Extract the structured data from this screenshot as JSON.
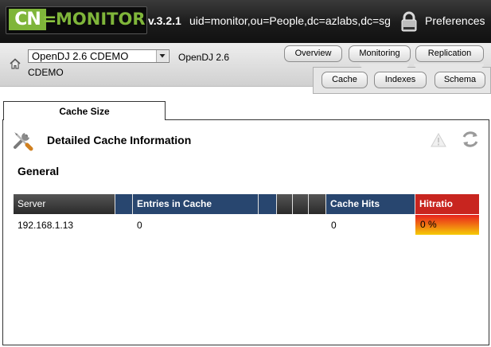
{
  "header": {
    "logo_cn": "CN",
    "logo_eq": "=",
    "logo_word": "MONITOR",
    "version": "v.3.2.1",
    "uid": "uid=monitor,ou=People,dc=azlabs,dc=sg",
    "lock_icon": "lock-icon",
    "preferences": "Preferences",
    "colors": {
      "background": "#1b1b1b",
      "logo_green": "#7fb53a"
    }
  },
  "server_bar": {
    "home_icon": "home-icon",
    "selected_server": "OpenDJ 2.6 CDEMO",
    "server_name_line1": "OpenDJ 2.6",
    "server_name_line2": "CDEMO"
  },
  "nav": {
    "tabs": [
      {
        "label": "Overview"
      },
      {
        "label": "Monitoring"
      },
      {
        "label": "Replication"
      }
    ],
    "subtabs": [
      {
        "label": "Cache"
      },
      {
        "label": "Indexes"
      },
      {
        "label": "Schema"
      }
    ]
  },
  "panel": {
    "tab_label": "Cache Size",
    "title": "Detailed Cache Information",
    "section": "General",
    "icons": {
      "tools": "tools-icon",
      "warning": "warning-icon",
      "refresh": "refresh-icon"
    }
  },
  "table": {
    "headers": {
      "server": "Server",
      "entries": "Entries in Cache",
      "hits": "Cache Hits",
      "hitratio": "Hitratio"
    },
    "rows": [
      {
        "server": "192.168.1.13",
        "entries": "0",
        "hits": "0",
        "hitratio": "0 %"
      }
    ],
    "colors": {
      "header_blue": "#28466f",
      "header_red": "#c8251f"
    }
  }
}
